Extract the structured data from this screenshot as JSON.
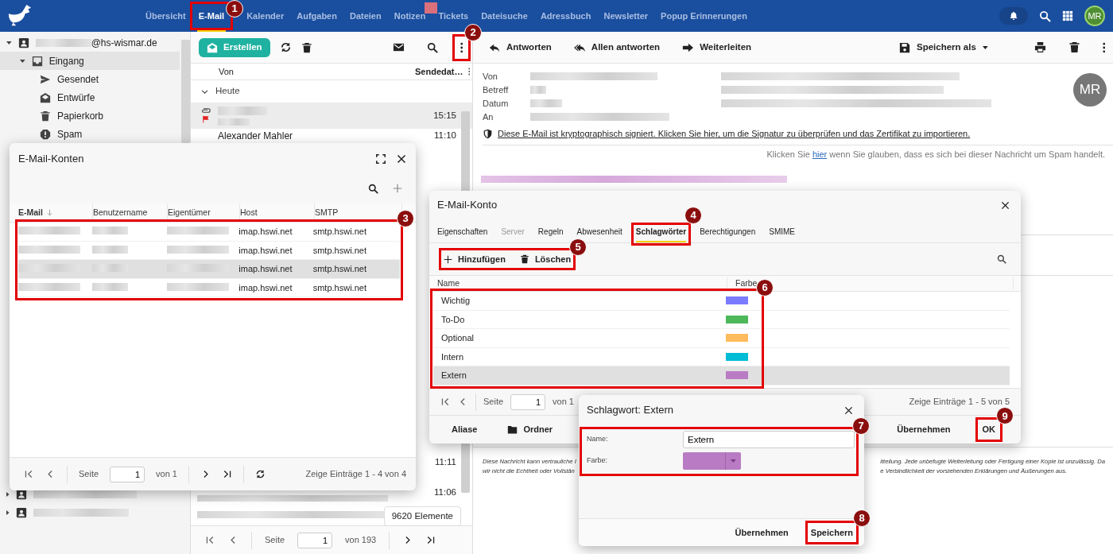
{
  "nav": {
    "items": [
      {
        "label": "Übersicht",
        "selected": false
      },
      {
        "label": "E-Mail",
        "selected": true
      },
      {
        "label": "Kalender",
        "selected": false
      },
      {
        "label": "Aufgaben",
        "selected": false
      },
      {
        "label": "Dateien",
        "selected": false
      },
      {
        "label": "Notizen",
        "selected": false
      },
      {
        "label": "Tickets",
        "selected": false
      },
      {
        "label": "Dateisuche",
        "selected": false
      },
      {
        "label": "Adressbuch",
        "selected": false
      },
      {
        "label": "Newsletter",
        "selected": false
      },
      {
        "label": "Popup Erinnerungen",
        "selected": false
      }
    ],
    "avatar": "MR"
  },
  "sidebar": {
    "account": "@hs-wismar.de",
    "folders": [
      {
        "label": "Eingang",
        "kind": "inbox",
        "selected": true,
        "expanded": true
      },
      {
        "label": "Gesendet",
        "kind": "sent",
        "selected": false
      },
      {
        "label": "Entwürfe",
        "kind": "drafts",
        "selected": false
      },
      {
        "label": "Papierkorb",
        "kind": "trash",
        "selected": false
      },
      {
        "label": "Spam",
        "kind": "spam",
        "selected": false
      }
    ]
  },
  "mail_list": {
    "create": "Erstellen",
    "columns": [
      "Von",
      "Sendedat…"
    ],
    "group": "Heute",
    "rows": [
      {
        "time": "15:15",
        "selected": true,
        "flagged": true,
        "attachment": true
      },
      {
        "sender": "Alexander Mahler",
        "time": "11:10",
        "selected": false,
        "flagged": false,
        "attachment": false
      }
    ],
    "lower_rows": [
      {
        "time": "11:11"
      },
      {
        "time": "11:06"
      }
    ],
    "count": "9620 Elemente",
    "pager": {
      "label": "Seite",
      "page": "1",
      "of": "von 193"
    }
  },
  "reader": {
    "toolbar": {
      "reply": "Antworten",
      "reply_all": "Allen antworten",
      "forward": "Weiterleiten",
      "save": "Speichern als"
    },
    "header_labels": [
      "Von",
      "Betreff",
      "Datum",
      "An"
    ],
    "avatar": "MR",
    "signature_notice": "Diese E-Mail ist kryptographisch signiert. Klicken Sie hier, um die Signatur zu überprüfen und das Zertifikat zu importieren.",
    "spam_notice": {
      "before": "Klicken Sie",
      "link": "hier",
      "after": "wenn Sie glauben, dass es sich bei dieser Nachricht um Spam handelt."
    },
    "disclaimer": {
      "left": [
        "Diese Nachricht kann vertrauliche I",
        "wir nicht die Echtheit oder Vollstän"
      ],
      "right": [
        "itteilung. Jede unbefugte Weiterleitung oder Fertigung einer Kopie ist unzulässig. Da",
        "e Verbindlichkeit der vorstehenden Erklärungen und Äußerungen aus."
      ]
    }
  },
  "accounts_dialog": {
    "title": "E-Mail-Konten",
    "columns": [
      {
        "label": "E-Mail",
        "sorted": true
      },
      {
        "label": "Benutzername",
        "sorted": false
      },
      {
        "label": "Eigentümer",
        "sorted": false
      },
      {
        "label": "Host",
        "sorted": false
      },
      {
        "label": "SMTP",
        "sorted": false
      }
    ],
    "rows": [
      {
        "host": "imap.hswi.net",
        "smtp": "smtp.hswi.net",
        "selected": false
      },
      {
        "host": "imap.hswi.net",
        "smtp": "smtp.hswi.net",
        "selected": false
      },
      {
        "host": "imap.hswi.net",
        "smtp": "smtp.hswi.net",
        "selected": true
      },
      {
        "host": "imap.hswi.net",
        "smtp": "smtp.hswi.net",
        "selected": false
      }
    ],
    "pager": {
      "label": "Seite",
      "page": "1",
      "of": "von 1",
      "summary": "Zeige Einträge 1 - 4 von 4"
    }
  },
  "account_dialog": {
    "title": "E-Mail-Konto",
    "tabs": [
      {
        "label": "Eigenschaften",
        "selected": false,
        "disabled": false
      },
      {
        "label": "Server",
        "selected": false,
        "disabled": true
      },
      {
        "label": "Regeln",
        "selected": false,
        "disabled": false
      },
      {
        "label": "Abwesenheit",
        "selected": false,
        "disabled": false
      },
      {
        "label": "Schlagwörter",
        "selected": true,
        "disabled": false
      },
      {
        "label": "Berechtigungen",
        "selected": false,
        "disabled": false
      },
      {
        "label": "SMIME",
        "selected": false,
        "disabled": false
      }
    ],
    "add": "Hinzufügen",
    "delete": "Löschen",
    "columns": [
      "Name",
      "Farbe"
    ],
    "tags": [
      {
        "name": "Wichtig",
        "color": "#7b7bff",
        "selected": false
      },
      {
        "name": "To-Do",
        "color": "#4cb85a",
        "selected": false
      },
      {
        "name": "Optional",
        "color": "#ffbb5c",
        "selected": false
      },
      {
        "name": "Intern",
        "color": "#00bcd4",
        "selected": false
      },
      {
        "name": "Extern",
        "color": "#b97cc4",
        "selected": true
      }
    ],
    "pager": {
      "label": "Seite",
      "page": "1",
      "of": "von 1",
      "summary": "Zeige Einträge 1 - 5 von 5"
    },
    "footer": {
      "aliases": "Aliase",
      "folders": "Ordner",
      "apply": "Übernehmen",
      "ok": "OK"
    }
  },
  "tag_dialog": {
    "title": "Schlagwort: Extern",
    "name_label": "Name:",
    "name_value": "Extern",
    "color_label": "Farbe:",
    "color": "#b97cc4",
    "apply": "Übernehmen",
    "save": "Speichern"
  },
  "annotations": [
    {
      "number": "1"
    },
    {
      "number": "2"
    },
    {
      "number": "3"
    },
    {
      "number": "4"
    },
    {
      "number": "5"
    },
    {
      "number": "6"
    },
    {
      "number": "7"
    },
    {
      "number": "8"
    },
    {
      "number": "9"
    }
  ]
}
